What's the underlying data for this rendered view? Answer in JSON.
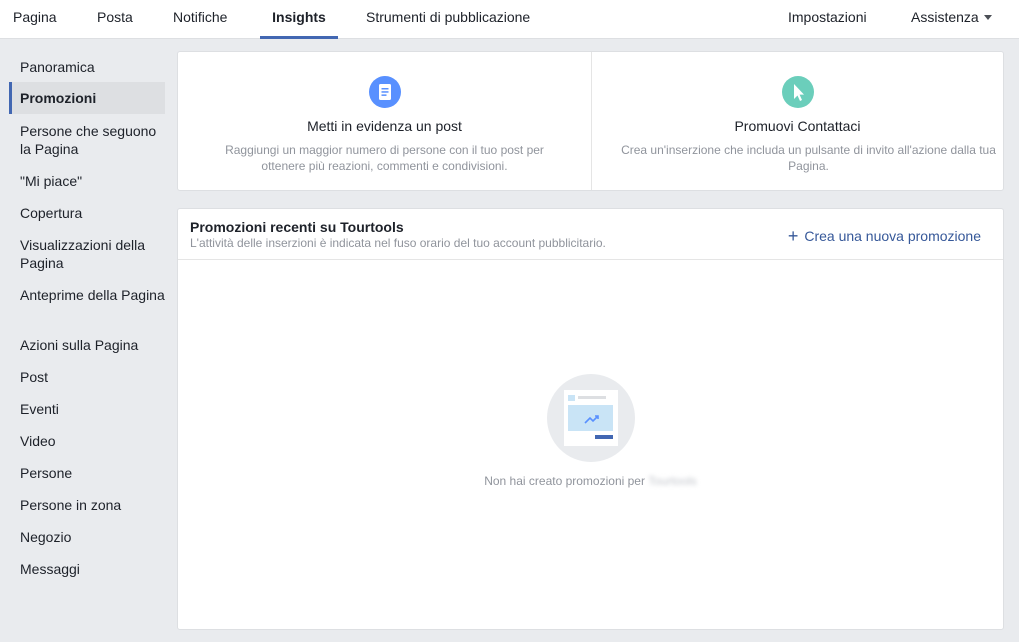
{
  "nav": {
    "tabs": [
      {
        "label": "Pagina"
      },
      {
        "label": "Posta"
      },
      {
        "label": "Notifiche"
      },
      {
        "label": "Insights"
      },
      {
        "label": "Strumenti di pubblicazione"
      }
    ],
    "right": {
      "settings": "Impostazioni",
      "help": "Assistenza"
    },
    "active_tab": "Insights"
  },
  "sidebar": {
    "items": [
      {
        "label": "Panoramica"
      },
      {
        "label": "Promozioni"
      },
      {
        "label": "Persone che seguono la Pagina"
      },
      {
        "label": "\"Mi piace\""
      },
      {
        "label": "Copertura"
      },
      {
        "label": "Visualizzazioni della Pagina"
      },
      {
        "label": "Anteprime della Pagina"
      },
      {
        "label": "Azioni sulla Pagina"
      },
      {
        "label": "Post"
      },
      {
        "label": "Eventi"
      },
      {
        "label": "Video"
      },
      {
        "label": "Persone"
      },
      {
        "label": "Persone in zona"
      },
      {
        "label": "Negozio"
      },
      {
        "label": "Messaggi"
      }
    ],
    "active": "Promozioni"
  },
  "promos": {
    "boost_post": {
      "title": "Metti in evidenza un post",
      "description": "Raggiungi un maggior numero di persone con il tuo post per ottenere più reazioni, commenti e condivisioni.",
      "icon": "document-icon",
      "color": "#5890ff"
    },
    "promote_contact": {
      "title": "Promuovi Contattaci",
      "description": "Crea un'inserzione che includa un pulsante di invito all'azione dalla tua Pagina.",
      "icon": "cursor-icon",
      "color": "#6bcebb"
    }
  },
  "recent": {
    "title": "Promozioni recenti su Tourtools",
    "subtitle": "L'attività delle inserzioni è indicata nel fuso orario del tuo account pubblicitario.",
    "create_label": "Crea una nuova promozione",
    "empty_text": "Non hai creato promozioni per",
    "empty_page_name": "Tourtools"
  },
  "colors": {
    "accent": "#4267b2",
    "link": "#365899",
    "background": "#e9ebee"
  }
}
